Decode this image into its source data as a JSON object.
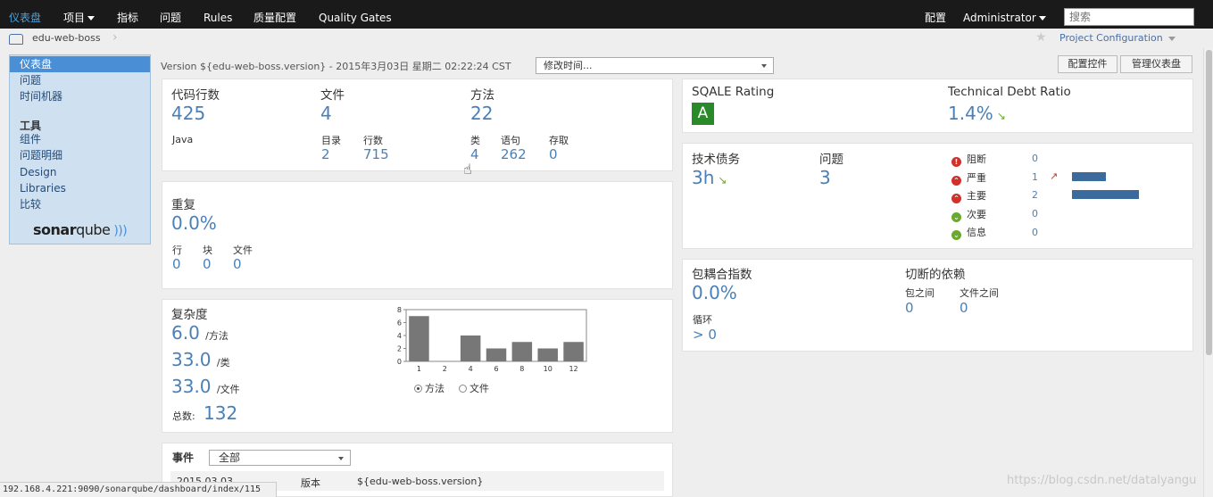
{
  "nav": {
    "items": [
      {
        "label": "仪表盘"
      },
      {
        "label": "项目"
      },
      {
        "label": "指标"
      },
      {
        "label": "问题"
      },
      {
        "label": "Rules"
      },
      {
        "label": "质量配置"
      },
      {
        "label": "Quality Gates"
      }
    ],
    "right_config": "配置",
    "user": "Administrator",
    "search_placeholder": "搜索"
  },
  "breadcrumb": {
    "project": "edu-web-boss",
    "project_configuration": "Project Configuration"
  },
  "sidebar": {
    "items": [
      "仪表盘",
      "问题",
      "时间机器"
    ],
    "tools_heading": "工具",
    "tools": [
      "组件",
      "问题明细",
      "Design",
      "Libraries",
      "比较"
    ],
    "logo_bold": "sonar",
    "logo_rest": "qube"
  },
  "version_bar": {
    "text": "Version ${edu-web-boss.version} - 2015年3月03日 星期二 02:22:24 CST",
    "select_value": "修改时间...",
    "btn_config": "配置控件",
    "btn_manage": "管理仪表盘"
  },
  "size": {
    "loc_label": "代码行数",
    "loc_value": "425",
    "loc_lang": "Java",
    "files_label": "文件",
    "files_value": "4",
    "dirs_label": "目录",
    "dirs_value": "2",
    "lines_label": "行数",
    "lines_value": "715",
    "functions_label": "方法",
    "functions_value": "22",
    "classes_label": "类",
    "classes_value": "4",
    "statements_label": "语句",
    "statements_value": "262",
    "accessors_label": "存取",
    "accessors_value": "0"
  },
  "duplications": {
    "label": "重复",
    "value": "0.0%",
    "lines_label": "行",
    "lines_value": "0",
    "blocks_label": "块",
    "blocks_value": "0",
    "files_label": "文件",
    "files_value": "0"
  },
  "complexity": {
    "label": "复杂度",
    "per_function": "6.0",
    "per_function_unit": "/方法",
    "per_class": "33.0",
    "per_class_unit": "/类",
    "per_file": "33.0",
    "per_file_unit": "/文件",
    "total_label": "总数:",
    "total_value": "132",
    "radio_function": "方法",
    "radio_file": "文件"
  },
  "chart_data": {
    "type": "bar",
    "categories": [
      "1",
      "2",
      "4",
      "6",
      "8",
      "10",
      "12"
    ],
    "values": [
      7,
      0,
      4,
      2,
      3,
      2,
      3
    ],
    "ylim": [
      0,
      8
    ],
    "yticks": [
      "0",
      "2",
      "4",
      "6",
      "8"
    ],
    "color": "#777777"
  },
  "events": {
    "label": "事件",
    "filter_value": "全部",
    "rows": [
      {
        "date": "2015.03.03",
        "type": "版本",
        "name": "${edu-web-boss.version}"
      }
    ]
  },
  "sqale": {
    "rating_label": "SQALE Rating",
    "rating_value": "A",
    "ratio_label": "Technical Debt Ratio",
    "ratio_value": "1.4%"
  },
  "issues": {
    "debt_label": "技术债务",
    "debt_value": "3h",
    "issues_label": "问题",
    "issues_value": "3",
    "severities": [
      {
        "label": "阻断",
        "count": "0",
        "color": "#d0312d",
        "bar": 0
      },
      {
        "label": "严重",
        "count": "1",
        "color": "#d0312d",
        "bar": 0.5
      },
      {
        "label": "主要",
        "count": "2",
        "color": "#d0312d",
        "bar": 1
      },
      {
        "label": "次要",
        "count": "0",
        "color": "#6aaa2a",
        "bar": 0
      },
      {
        "label": "信息",
        "count": "0",
        "color": "#6aaa2a",
        "bar": 0
      }
    ]
  },
  "design": {
    "tangle_label": "包耦合指数",
    "tangle_value": "0.0%",
    "cycles_label": "循环",
    "cycles_value": "> 0",
    "cut_label": "切断的依赖",
    "pkg_label": "包之间",
    "pkg_value": "0",
    "file_label": "文件之间",
    "file_value": "0"
  },
  "status_url": "192.168.4.221:9090/sonarqube/dashboard/index/115",
  "watermark": "https://blog.csdn.net/datalyangu"
}
